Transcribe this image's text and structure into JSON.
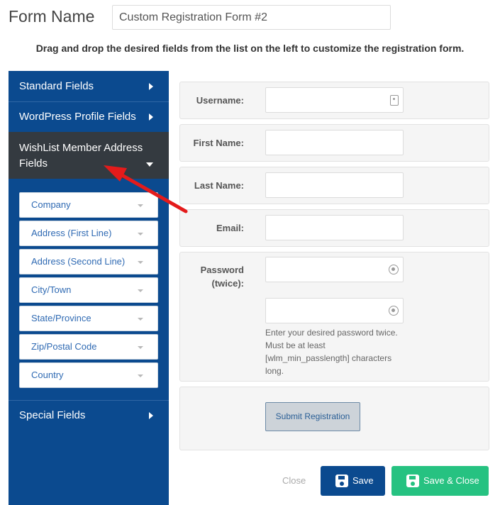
{
  "header": {
    "form_name_label": "Form Name",
    "form_name_value": "Custom Registration Form #2",
    "instructions": "Drag and drop the desired fields from the list on the left to customize the registration form."
  },
  "sidebar": {
    "sections": [
      {
        "label": "Standard Fields",
        "expanded": false
      },
      {
        "label": "WordPress Profile Fields",
        "expanded": false
      },
      {
        "label_line1": "WishList Member Address",
        "label_line2": "Fields",
        "expanded": true
      },
      {
        "label": "Special Fields",
        "expanded": false
      }
    ],
    "address_fields": [
      "Company",
      "Address (First Line)",
      "Address (Second Line)",
      "City/Town",
      "State/Province",
      "Zip/Postal Code",
      "Country"
    ]
  },
  "form": {
    "username_label": "Username:",
    "first_name_label": "First Name:",
    "last_name_label": "Last Name:",
    "email_label": "Email:",
    "password_label_line1": "Password",
    "password_label_line2": "(twice):",
    "password_hint": [
      "Enter your desired password twice.",
      "Must be at least",
      "[wlm_min_passlength] characters",
      "long."
    ],
    "submit_label": "Submit Registration"
  },
  "footer": {
    "close_label": "Close",
    "save_label": "Save",
    "save_close_label": "Save & Close"
  },
  "colors": {
    "sidebar_bg": "#0b4a8f",
    "sidebar_active_bg": "#343a40",
    "save_button": "#0b4a8f",
    "save_close_button": "#26c281",
    "annotation_arrow": "#e41b1b"
  },
  "icons": [
    "contact-card-icon",
    "key-icon",
    "save-icon",
    "caret-right-icon",
    "caret-down-icon",
    "red-arrow-annotation"
  ]
}
